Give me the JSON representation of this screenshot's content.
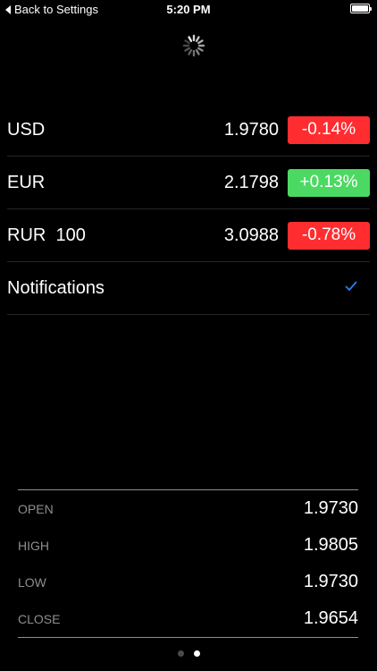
{
  "status_bar": {
    "back_label": "Back to Settings",
    "time": "5:20 PM"
  },
  "rates": [
    {
      "code": "USD",
      "value": "1.9780",
      "change": "-0.14%",
      "direction": "down"
    },
    {
      "code": "EUR",
      "value": "2.1798",
      "change": "+0.13%",
      "direction": "up"
    },
    {
      "code": "RUR  100",
      "value": "3.0988",
      "change": "-0.78%",
      "direction": "down"
    }
  ],
  "notifications": {
    "label": "Notifications",
    "checked": true
  },
  "ohlc": [
    {
      "label": "OPEN",
      "value": "1.9730"
    },
    {
      "label": "HIGH",
      "value": "1.9805"
    },
    {
      "label": "LOW",
      "value": "1.9730"
    },
    {
      "label": "CLOSE",
      "value": "1.9654"
    }
  ],
  "pager": {
    "pages": 2,
    "current": 2
  },
  "colors": {
    "negative": "#ff2d30",
    "positive": "#4cd963",
    "checkmark": "#2f7cf6",
    "background": "#000000"
  }
}
